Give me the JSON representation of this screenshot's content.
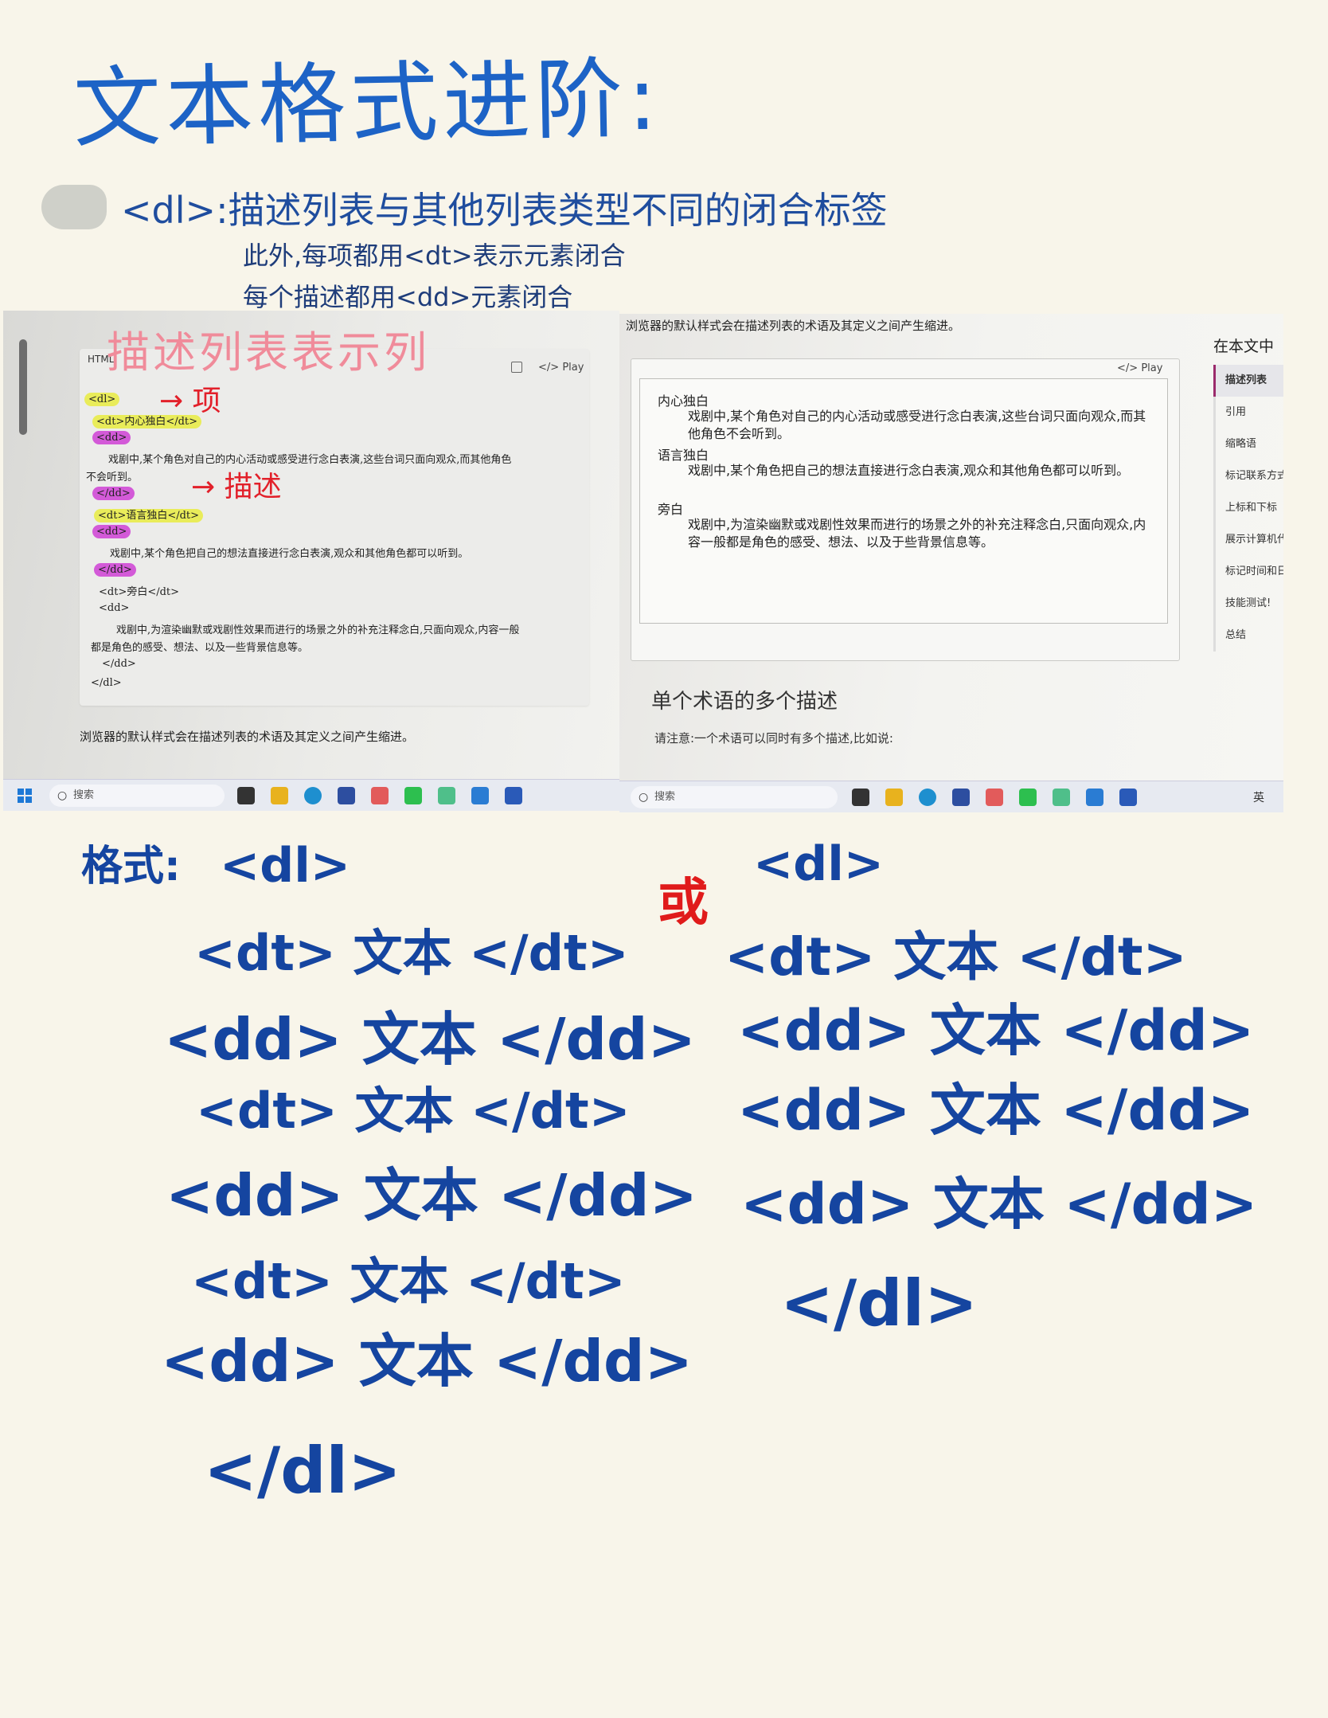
{
  "notes": {
    "title": "文本格式进阶:",
    "line1": "<dl>:描述列表与其他列表类型不同的闭合标签",
    "line2": "此外,每项都用<dt>表示元素闭合",
    "line3": "每个描述都用<dd>元素闭合"
  },
  "left_photo": {
    "annotation_title": "描述列表表示列",
    "annotation_item": "→ 项",
    "annotation_desc": "→ 描述",
    "code_label": "HTML",
    "play_label": "Play",
    "code_lines": [
      "<dl>",
      "<dt>内心独白</dt>",
      "<dd>",
      "戏剧中,某个角色对自己的内心活动或感受进行念白表演,这些台词只面向观众,而其他角色",
      "不会听到。",
      "</dd>",
      "<dt>语言独白</dt>",
      "<dd>",
      "戏剧中,某个角色把自己的想法直接进行念白表演,观众和其他角色都可以听到。",
      "</dd>",
      "<dt>旁白</dt>",
      "<dd>",
      "戏剧中,为渲染幽默或戏剧性效果而进行的场景之外的补充注释念白,只面向观众,内容一般",
      "都是角色的感受、想法、以及一些背景信息等。",
      "</dd>",
      "</dl>"
    ],
    "caption": "浏览器的默认样式会在描述列表的术语及其定义之间产生缩进。",
    "search_placeholder": "搜索"
  },
  "right_photo": {
    "caption_top": "浏览器的默认样式会在描述列表的术语及其定义之间产生缩进。",
    "play_label": "Play",
    "terms": [
      {
        "dt": "内心独白",
        "dd": "戏剧中,某个角色对自己的内心活动或感受进行念白表演,这些台词只面向观众,而其他角色不会听到。"
      },
      {
        "dt": "语言独白",
        "dd": "戏剧中,某个角色把自己的想法直接进行念白表演,观众和其他角色都可以听到。"
      },
      {
        "dt": "旁白",
        "dd": "戏剧中,为渲染幽默或戏剧性效果而进行的场景之外的补充注释念白,只面向观众,内容一般都是角色的感受、想法、以及于些背景信息等。"
      }
    ],
    "toc_title": "在本文中",
    "toc_items": [
      "描述列表",
      "引用",
      "缩略语",
      "标记联系方式",
      "上标和下标",
      "展示计算机代码",
      "标记时间和日期",
      "技能测试!",
      "总结"
    ],
    "heading": "单个术语的多个描述",
    "note": "请注意:一个术语可以同时有多个描述,比如说:",
    "search_placeholder": "搜索",
    "tray_lang": "英"
  },
  "handwritten_format": {
    "label": "格式:",
    "or_label": "或",
    "left": [
      "<dl>",
      "<dt> 文本 </dt>",
      "<dd> 文本 </dd>",
      "<dt> 文本 </dt>",
      "<dd> 文本 </dd>",
      "<dt> 文本 </dt>",
      "<dd> 文本 </dd>",
      "</dl>"
    ],
    "right": [
      "<dl>",
      "<dt> 文本 </dt>",
      "<dd> 文本 </dd>",
      "<dd> 文本 </dd>",
      "<dd> 文本 </dd>",
      "</dl>"
    ]
  }
}
